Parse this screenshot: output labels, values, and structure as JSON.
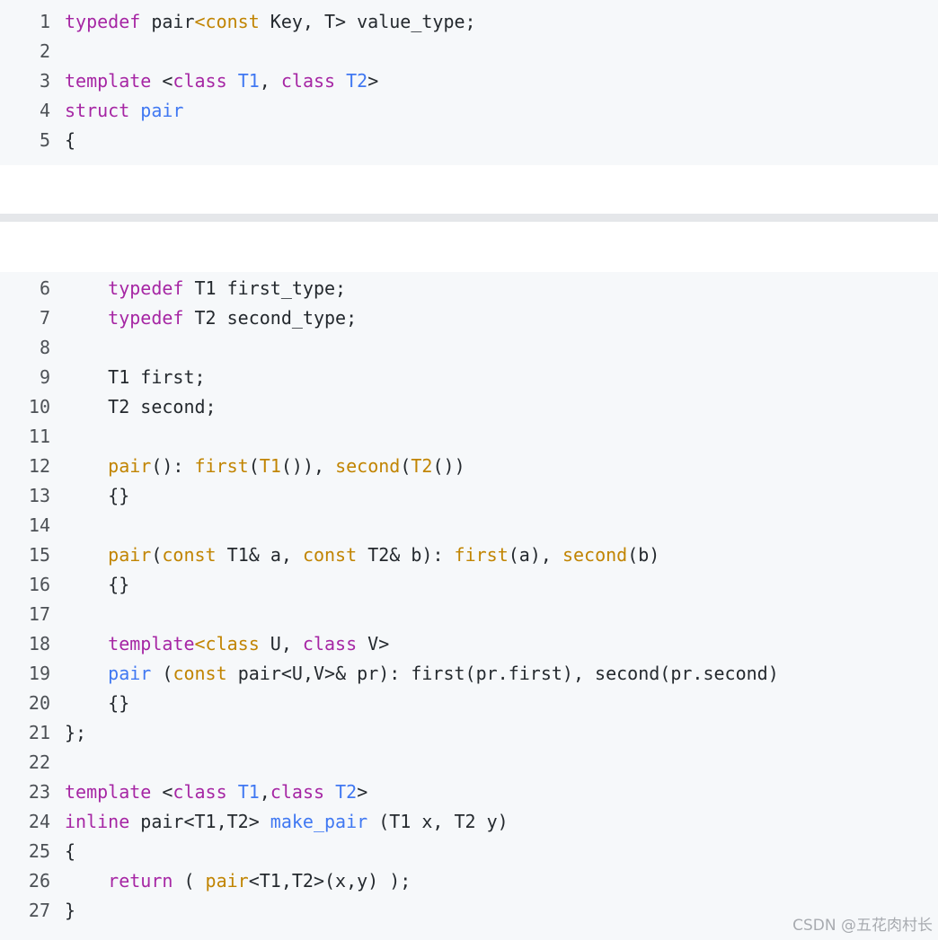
{
  "block1": {
    "lines": [
      {
        "n": "1",
        "tokens": [
          [
            "k",
            "typedef"
          ],
          [
            "p",
            " pair"
          ],
          [
            "f",
            "<const"
          ],
          [
            "p",
            " Key, T> value_type;"
          ]
        ]
      },
      {
        "n": "2",
        "tokens": []
      },
      {
        "n": "3",
        "tokens": [
          [
            "k",
            "template"
          ],
          [
            "p",
            " <"
          ],
          [
            "k",
            "class"
          ],
          [
            "p",
            " "
          ],
          [
            "t",
            "T1"
          ],
          [
            "p",
            ", "
          ],
          [
            "k",
            "class"
          ],
          [
            "p",
            " "
          ],
          [
            "t",
            "T2"
          ],
          [
            "p",
            ">"
          ]
        ]
      },
      {
        "n": "4",
        "tokens": [
          [
            "k",
            "struct"
          ],
          [
            "p",
            " "
          ],
          [
            "t",
            "pair"
          ]
        ]
      },
      {
        "n": "5",
        "tokens": [
          [
            "p",
            "{"
          ]
        ]
      }
    ]
  },
  "block2": {
    "lines": [
      {
        "n": "6",
        "tokens": [
          [
            "p",
            "    "
          ],
          [
            "k",
            "typedef"
          ],
          [
            "p",
            " T1 first_type;"
          ]
        ]
      },
      {
        "n": "7",
        "tokens": [
          [
            "p",
            "    "
          ],
          [
            "k",
            "typedef"
          ],
          [
            "p",
            " T2 second_type;"
          ]
        ]
      },
      {
        "n": "8",
        "tokens": []
      },
      {
        "n": "9",
        "tokens": [
          [
            "p",
            "    T1 first;"
          ]
        ]
      },
      {
        "n": "10",
        "tokens": [
          [
            "p",
            "    T2 second;"
          ]
        ]
      },
      {
        "n": "11",
        "tokens": []
      },
      {
        "n": "12",
        "tokens": [
          [
            "p",
            "    "
          ],
          [
            "f",
            "pair"
          ],
          [
            "p",
            "(): "
          ],
          [
            "f",
            "first"
          ],
          [
            "p",
            "("
          ],
          [
            "f",
            "T1"
          ],
          [
            "p",
            "()), "
          ],
          [
            "f",
            "second"
          ],
          [
            "p",
            "("
          ],
          [
            "f",
            "T2"
          ],
          [
            "p",
            "())"
          ]
        ]
      },
      {
        "n": "13",
        "tokens": [
          [
            "p",
            "    {}"
          ]
        ]
      },
      {
        "n": "14",
        "tokens": []
      },
      {
        "n": "15",
        "tokens": [
          [
            "p",
            "    "
          ],
          [
            "f",
            "pair"
          ],
          [
            "p",
            "("
          ],
          [
            "f",
            "const"
          ],
          [
            "p",
            " T1& a, "
          ],
          [
            "f",
            "const"
          ],
          [
            "p",
            " T2& b): "
          ],
          [
            "f",
            "first"
          ],
          [
            "p",
            "(a), "
          ],
          [
            "f",
            "second"
          ],
          [
            "p",
            "(b)"
          ]
        ]
      },
      {
        "n": "16",
        "tokens": [
          [
            "p",
            "    {}"
          ]
        ]
      },
      {
        "n": "17",
        "tokens": []
      },
      {
        "n": "18",
        "tokens": [
          [
            "p",
            "    "
          ],
          [
            "k",
            "template"
          ],
          [
            "f",
            "<class"
          ],
          [
            "p",
            " U, "
          ],
          [
            "k",
            "class"
          ],
          [
            "p",
            " V>"
          ]
        ]
      },
      {
        "n": "19",
        "tokens": [
          [
            "p",
            "    "
          ],
          [
            "t",
            "pair"
          ],
          [
            "p",
            " ("
          ],
          [
            "f",
            "const"
          ],
          [
            "p",
            " pair<U,V>& pr): first(pr.first), second(pr.second)"
          ]
        ]
      },
      {
        "n": "20",
        "tokens": [
          [
            "p",
            "    {}"
          ]
        ]
      },
      {
        "n": "21",
        "tokens": [
          [
            "p",
            "};"
          ]
        ]
      },
      {
        "n": "22",
        "tokens": []
      },
      {
        "n": "23",
        "tokens": [
          [
            "k",
            "template"
          ],
          [
            "p",
            " <"
          ],
          [
            "k",
            "class"
          ],
          [
            "p",
            " "
          ],
          [
            "t",
            "T1"
          ],
          [
            "p",
            ","
          ],
          [
            "k",
            "class"
          ],
          [
            "p",
            " "
          ],
          [
            "t",
            "T2"
          ],
          [
            "p",
            ">"
          ]
        ]
      },
      {
        "n": "24",
        "tokens": [
          [
            "k",
            "inline"
          ],
          [
            "p",
            " pair<T1,T2> "
          ],
          [
            "t",
            "make_pair"
          ],
          [
            "p",
            " (T1 x, T2 y)"
          ]
        ]
      },
      {
        "n": "25",
        "tokens": [
          [
            "p",
            "{"
          ]
        ]
      },
      {
        "n": "26",
        "tokens": [
          [
            "p",
            "    "
          ],
          [
            "k",
            "return"
          ],
          [
            "p",
            " ( "
          ],
          [
            "f",
            "pair"
          ],
          [
            "p",
            "<T1,T2>(x,y) );"
          ]
        ]
      },
      {
        "n": "27",
        "tokens": [
          [
            "p",
            "}"
          ]
        ]
      }
    ]
  },
  "watermark": "CSDN @五花肉村长",
  "colors": {
    "keyword": "#a626a4",
    "type": "#4078f2",
    "function": "#c18401",
    "plain": "#24292e",
    "background": "#f6f8fa"
  }
}
